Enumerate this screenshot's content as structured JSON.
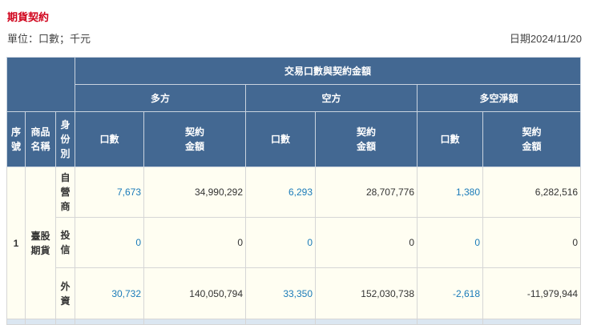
{
  "title": "期貨契約",
  "unit": "單位：口數；千元",
  "date": "日期2024/11/20",
  "header": {
    "group": "交易口數與契約金額",
    "long": "多方",
    "short": "空方",
    "net": "多空淨額",
    "seq": "序\n號",
    "product": "商品\n名稱",
    "identity": "身\n份\n別",
    "lots": "口數",
    "amount": "契約\n金額"
  },
  "row": {
    "seq": "1",
    "product": "臺股\n期貨",
    "items": [
      {
        "identity": "自\n營\n商",
        "long_lots": "7,673",
        "long_amt": "34,990,292",
        "short_lots": "6,293",
        "short_amt": "28,707,776",
        "net_lots": "1,380",
        "net_amt": "6,282,516"
      },
      {
        "identity": "投\n信",
        "long_lots": "0",
        "long_amt": "0",
        "short_lots": "0",
        "short_amt": "0",
        "net_lots": "0",
        "net_amt": "0"
      },
      {
        "identity": "外\n資",
        "long_lots": "30,732",
        "long_amt": "140,050,794",
        "short_lots": "33,350",
        "short_amt": "152,030,738",
        "net_lots": "-2,618",
        "net_amt": "-11,979,944"
      }
    ]
  }
}
